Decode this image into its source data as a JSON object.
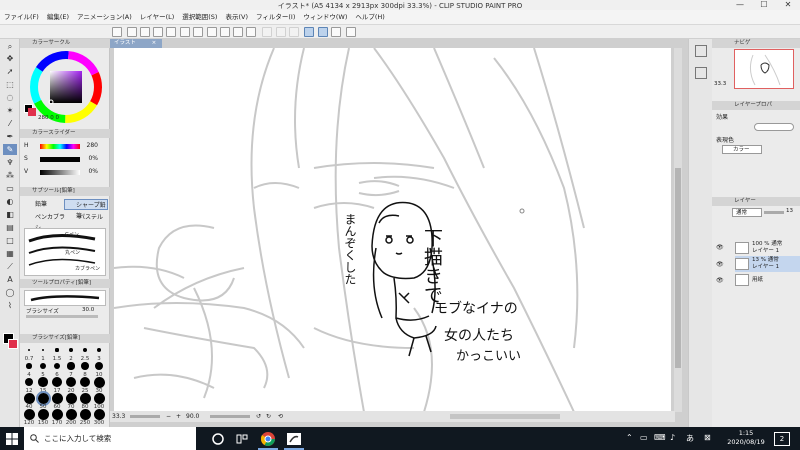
{
  "window": {
    "title": "イラスト* (A5 4134 x 2913px 300dpi 33.3%) - CLIP STUDIO PAINT PRO",
    "minimize": "—",
    "maximize": "☐",
    "close": "✕"
  },
  "menu": [
    "ファイル(F)",
    "編集(E)",
    "アニメーション(A)",
    "レイヤー(L)",
    "選択範囲(S)",
    "表示(V)",
    "フィルター(I)",
    "ウィンドウ(W)",
    "ヘルプ(H)"
  ],
  "document": {
    "tab_label": "イラスト",
    "tab_close": "×"
  },
  "color_wheel": {
    "title": "カラーサークル",
    "hsv_readout": [
      "280",
      "0",
      "0"
    ]
  },
  "color_slider": {
    "title": "カラースライダー",
    "rows": [
      {
        "label": "H",
        "value": "280"
      },
      {
        "label": "S",
        "value": "0%"
      },
      {
        "label": "V",
        "value": "0%"
      }
    ]
  },
  "sub_tool": {
    "title": "サブツール[鉛筆]",
    "tabs": [
      "鉛筆",
      "シャープ鉛筆",
      "ペンカブラシ",
      "パステル"
    ],
    "brushes": [
      "Gペン",
      "丸ペン",
      "カブラペン",
      "鉛筆",
      "濃い鉛筆"
    ],
    "active_label": "鉛筆"
  },
  "tool_property": {
    "title": "ツールプロパティ[鉛筆]",
    "current": "濃い鉛筆",
    "brush_size_label": "ブラシサイズ",
    "brush_size_value": "30.0"
  },
  "brush_size": {
    "title": "ブラシサイズ[鉛筆]",
    "sizes": [
      "0.7",
      "1",
      "1.5",
      "2",
      "2.5",
      "3",
      "4",
      "5",
      "6",
      "7",
      "8",
      "10",
      "12",
      "15",
      "17",
      "20",
      "25",
      "30",
      "40",
      "50",
      "60",
      "70",
      "80",
      "100",
      "120",
      "150",
      "170",
      "200",
      "250",
      "300"
    ],
    "selected": "50"
  },
  "canvas_text": {
    "line1": "下描きで",
    "line2": "まんぞくした",
    "line3": "モブなイナの",
    "line4": "女の人たち",
    "line5": "かっこいい"
  },
  "status": {
    "zoom": "33.3",
    "angle": "90.0"
  },
  "navigator": {
    "title": "ナビゲ",
    "zoom": "33.3"
  },
  "layer_property": {
    "title": "レイヤープロパ",
    "effect_label": "効果",
    "expression_color_label": "表現色",
    "expression_color_value": "カラー"
  },
  "layers": {
    "title": "レイヤー",
    "blend_mode": "通常",
    "opacity": "13",
    "items": [
      {
        "line1": "100 % 通常",
        "line2": "レイヤー 1",
        "selected": false
      },
      {
        "line1": "13 % 通常",
        "line2": "レイヤー 1",
        "selected": true
      },
      {
        "line1": "",
        "line2": "用紙",
        "selected": false
      }
    ]
  },
  "taskbar": {
    "search_placeholder": "ここに入力して検索",
    "time": "1:15",
    "date": "2020/08/19",
    "ime": "あ",
    "notification_count": "2"
  },
  "colors": {
    "accent": "#6d8fc0",
    "taskbar": "#101820",
    "sketch": "#c8c8c8",
    "ink": "#111111"
  }
}
